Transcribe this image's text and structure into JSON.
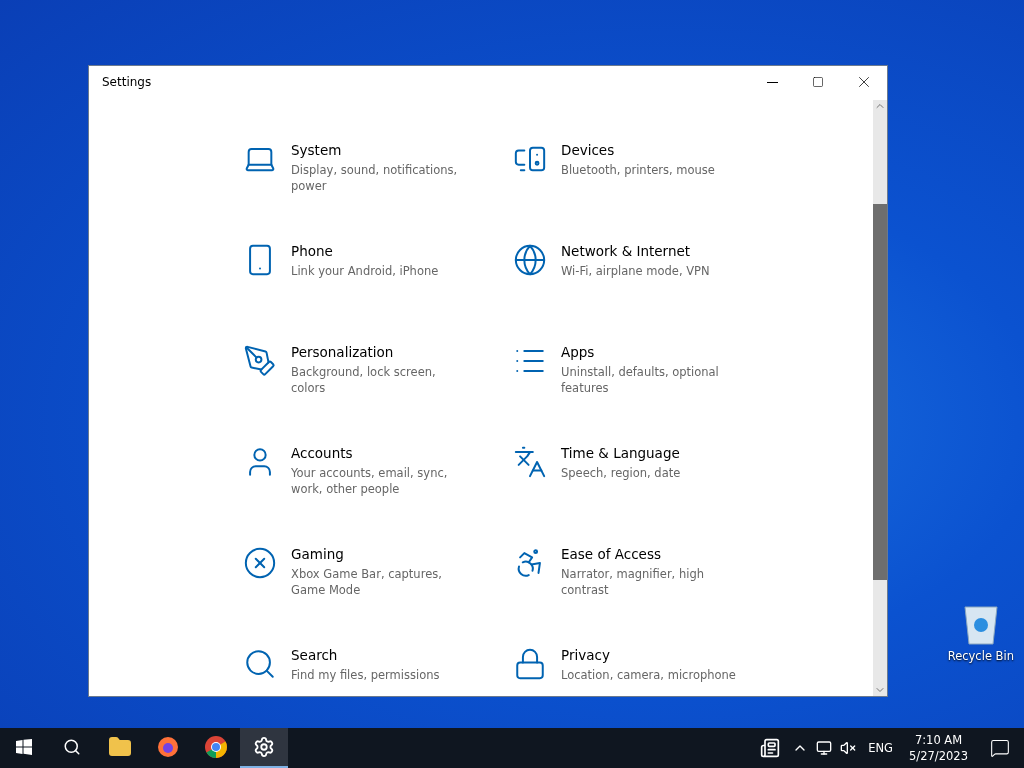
{
  "window": {
    "title": "Settings"
  },
  "categories": [
    {
      "title": "System",
      "description": "Display, sound, notifications, power"
    },
    {
      "title": "Devices",
      "description": "Bluetooth, printers, mouse"
    },
    {
      "title": "Phone",
      "description": "Link your Android, iPhone"
    },
    {
      "title": "Network & Internet",
      "description": "Wi-Fi, airplane mode, VPN"
    },
    {
      "title": "Personalization",
      "description": "Background, lock screen, colors"
    },
    {
      "title": "Apps",
      "description": "Uninstall, defaults, optional features"
    },
    {
      "title": "Accounts",
      "description": "Your accounts, email, sync, work, other people"
    },
    {
      "title": "Time & Language",
      "description": "Speech, region, date"
    },
    {
      "title": "Gaming",
      "description": "Xbox Game Bar, captures, Game Mode"
    },
    {
      "title": "Ease of Access",
      "description": "Narrator, magnifier, high contrast"
    },
    {
      "title": "Search",
      "description": "Find my files, permissions"
    },
    {
      "title": "Privacy",
      "description": "Location, camera, microphone"
    }
  ],
  "desktop_icons": [
    {
      "label": "Recycle Bin"
    }
  ],
  "taskbar": {
    "apps": [
      {
        "selected": false
      },
      {
        "selected": false
      },
      {
        "selected": false
      },
      {
        "selected": false
      },
      {
        "selected": true
      }
    ],
    "language": "ENG",
    "time": "7:10 AM",
    "date": "5/27/2023"
  }
}
